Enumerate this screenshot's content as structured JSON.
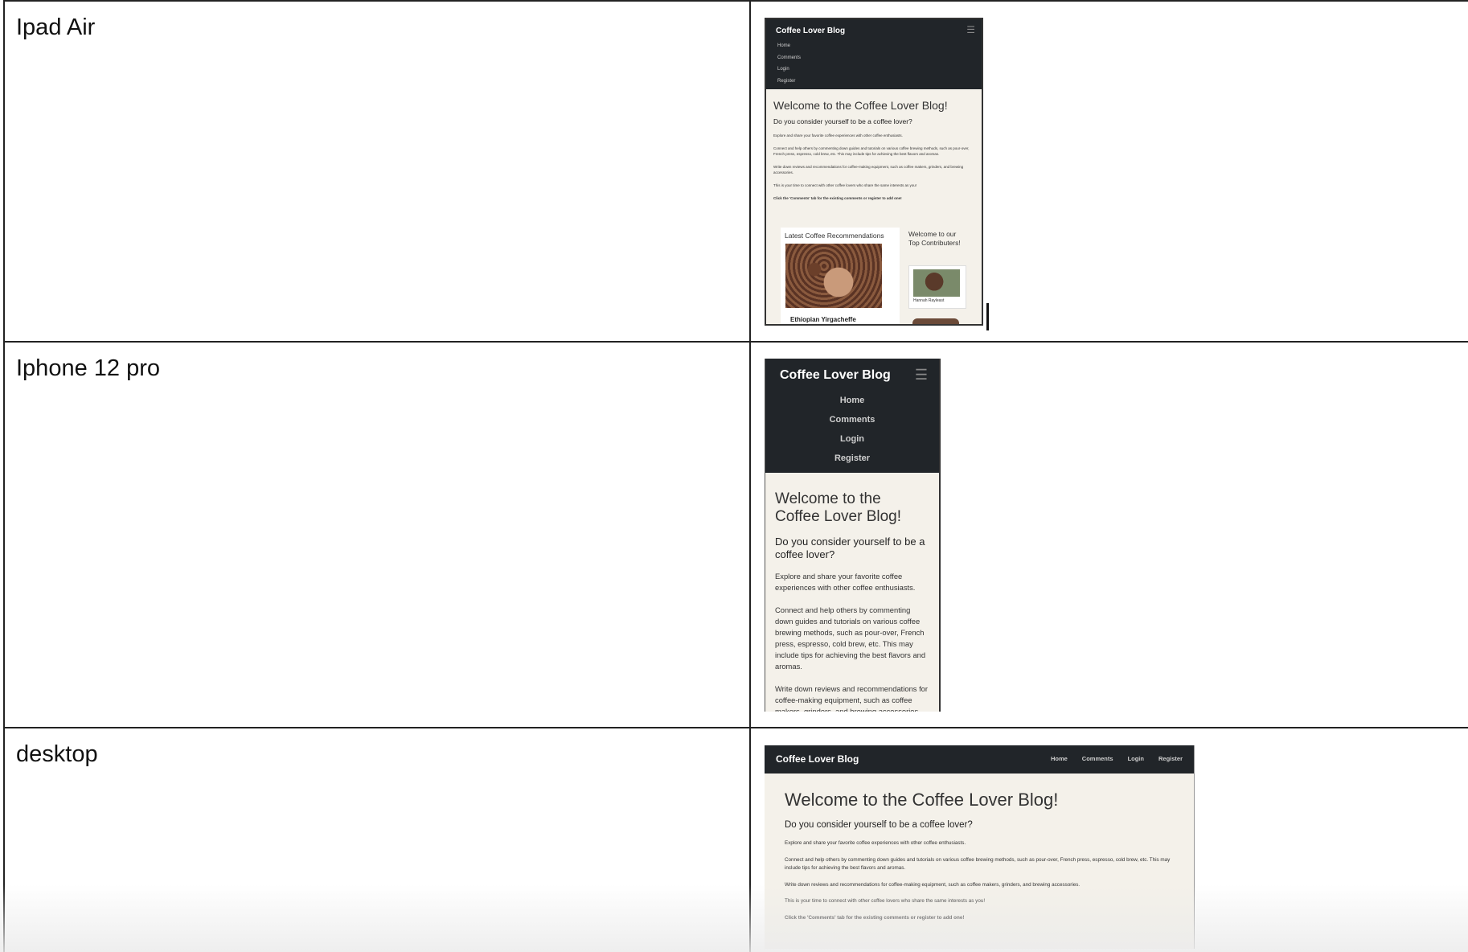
{
  "rows": [
    {
      "label": "Ipad Air"
    },
    {
      "label": "Iphone 12 pro"
    },
    {
      "label": "desktop"
    }
  ],
  "site": {
    "brand": "Coffee Lover Blog",
    "nav": [
      "Home",
      "Comments",
      "Login",
      "Register"
    ],
    "heading": "Welcome to the Coffee Lover Blog!",
    "subheading": "Do you consider yourself to be a coffee lover?",
    "paragraphs": [
      "Explore and share your favorite coffee experiences with other coffee enthusiasts.",
      "Connect and help others by commenting down guides and tutorials on various coffee brewing methods, such as pour-over, French press, espresso, cold brew, etc. This may include tips for achieving the best flavors and aromas.",
      "Write down reviews and recommendations for coffee-making equipment, such as coffee makers, grinders, and brewing accessories.",
      "This is your time to connect with other coffee lovers who share the same interests as you!",
      "Click the 'Comments' tab for the existing comments or register to add one!"
    ],
    "recommendations_title": "Latest Coffee Recommendations",
    "recommendation_name": "Ethiopian Yirgacheffe",
    "contributors_title": "Welcome to our Top Contributers!",
    "contributor_name": "Hannah Rayleast"
  },
  "colors": {
    "navbar": "#212529",
    "page_bg": "#f4f1ea",
    "border": "#222222"
  }
}
